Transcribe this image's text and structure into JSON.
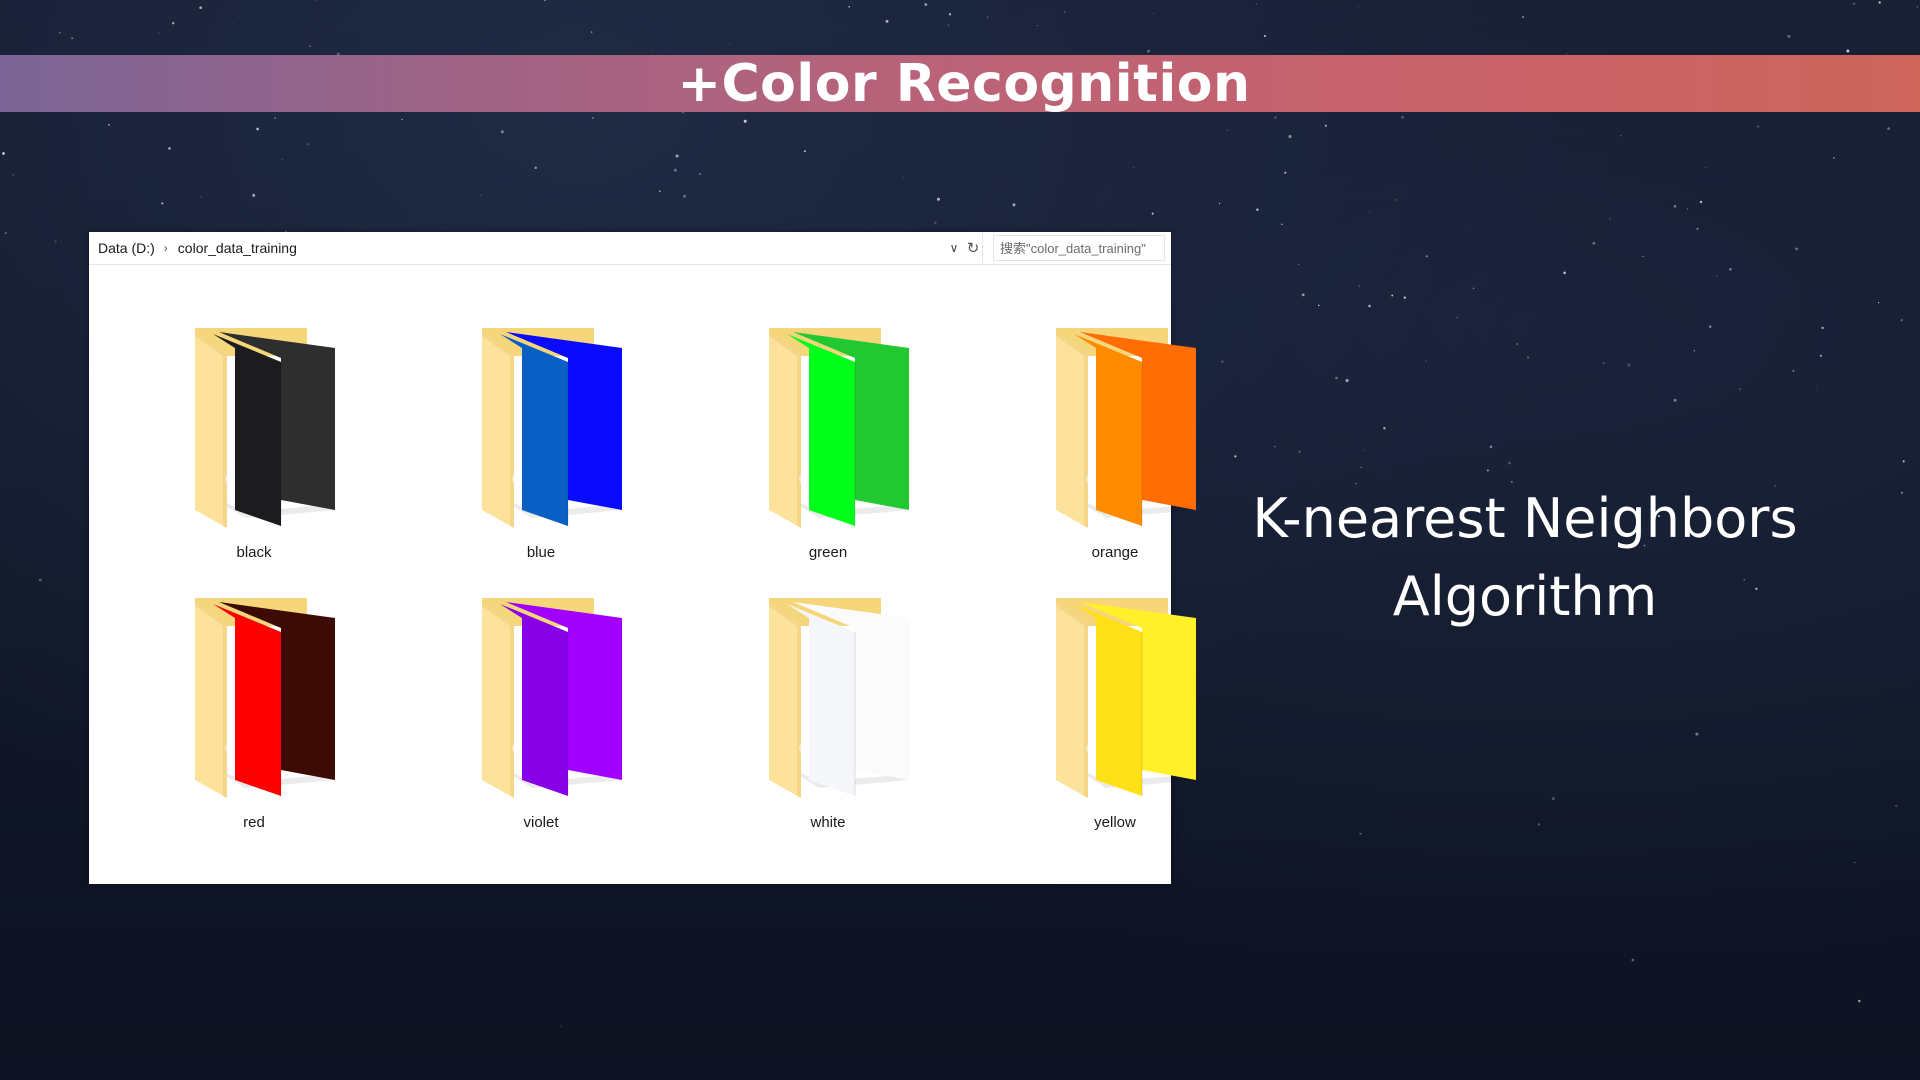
{
  "slide": {
    "title": "+Color Recognition",
    "subtitle_line1": "K-nearest Neighbors",
    "subtitle_line2": "Algorithm"
  },
  "explorer": {
    "breadcrumb": [
      "Data (D:)",
      "color_data_training"
    ],
    "search_placeholder": "搜索\"color_data_training\"",
    "folders": [
      {
        "name": "black",
        "front": "#1c1c1e",
        "back": "#2e2e2e"
      },
      {
        "name": "blue",
        "front": "#0a5fc4",
        "back": "#0a0aff"
      },
      {
        "name": "green",
        "front": "#00ff1a",
        "back": "#22c832"
      },
      {
        "name": "orange",
        "front": "#ff8c00",
        "back": "#ff6e05"
      },
      {
        "name": "red",
        "front": "#ff0000",
        "back": "#3d0a05"
      },
      {
        "name": "violet",
        "front": "#8800e6",
        "back": "#a100ff"
      },
      {
        "name": "white",
        "front": "#f4f6fa",
        "back": "#fbfbfb"
      },
      {
        "name": "yellow",
        "front": "#ffe016",
        "back": "#fff02a"
      }
    ]
  },
  "icons": {
    "breadcrumb_separator": "chevron-right-icon",
    "dropdown": "chevron-down-icon",
    "refresh": "refresh-icon",
    "folder": "folder-icon"
  },
  "colors": {
    "title_bar_start": "#7a6596",
    "title_bar_end": "#cd655b",
    "background": "#131a2c",
    "folder_tab": "#f6d67a",
    "folder_body": "#fde29b"
  }
}
